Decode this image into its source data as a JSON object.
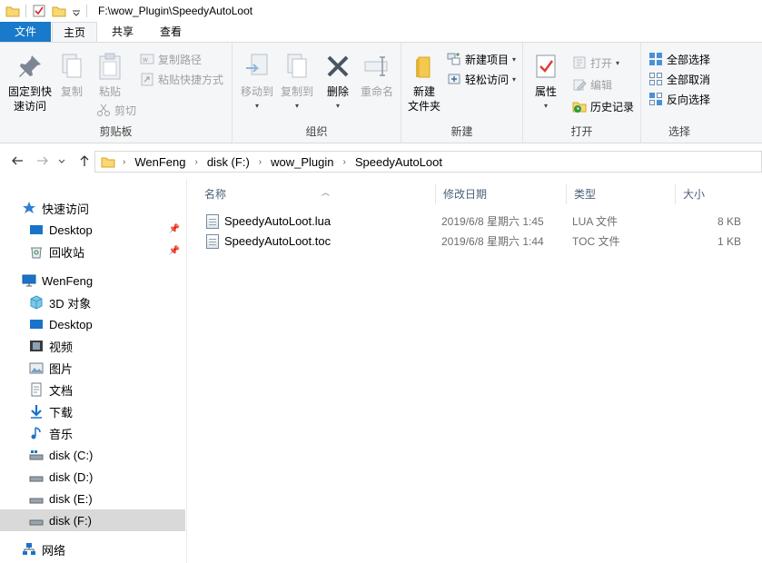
{
  "window": {
    "title": "F:\\wow_Plugin\\SpeedyAutoLoot"
  },
  "tabs": {
    "file": "文件",
    "home": "主页",
    "share": "共享",
    "view": "查看"
  },
  "ribbon": {
    "clipboard": {
      "label": "剪贴板",
      "pin_quick_access": "固定到快\n速访问",
      "copy": "复制",
      "paste": "粘贴",
      "copy_path": "复制路径",
      "paste_shortcut": "粘贴快捷方式",
      "cut": "剪切"
    },
    "organize": {
      "label": "组织",
      "move_to": "移动到",
      "copy_to": "复制到",
      "delete": "删除",
      "rename": "重命名"
    },
    "new": {
      "label": "新建",
      "new_folder": "新建\n文件夹",
      "new_item": "新建项目",
      "easy_access": "轻松访问"
    },
    "open": {
      "label": "打开",
      "properties": "属性",
      "open": "打开",
      "edit": "编辑",
      "history": "历史记录"
    },
    "select": {
      "label": "选择",
      "select_all": "全部选择",
      "select_none": "全部取消",
      "invert": "反向选择"
    }
  },
  "address": {
    "crumbs": [
      "WenFeng",
      "disk (F:)",
      "wow_Plugin",
      "SpeedyAutoLoot"
    ]
  },
  "nav": {
    "quick_access": "快速访问",
    "qa_desktop": "Desktop",
    "qa_recycle": "回收站",
    "pc": "WenFeng",
    "objects3d": "3D 对象",
    "desktop": "Desktop",
    "videos": "视频",
    "pictures": "图片",
    "documents": "文档",
    "downloads": "下载",
    "music": "音乐",
    "disk_c": "disk (C:)",
    "disk_d": "disk (D:)",
    "disk_e": "disk (E:)",
    "disk_f": "disk (F:)",
    "network": "网络"
  },
  "columns": {
    "name": "名称",
    "modified": "修改日期",
    "type": "类型",
    "size": "大小"
  },
  "files": [
    {
      "name": "SpeedyAutoLoot.lua",
      "modified": "2019/6/8 星期六 1:45",
      "type": "LUA 文件",
      "size": "8 KB"
    },
    {
      "name": "SpeedyAutoLoot.toc",
      "modified": "2019/6/8 星期六 1:44",
      "type": "TOC 文件",
      "size": "1 KB"
    }
  ],
  "colors": {
    "accent": "#1979ca",
    "ribbon_bg": "#f5f6f7",
    "selected_bg": "#d9d9d9"
  }
}
